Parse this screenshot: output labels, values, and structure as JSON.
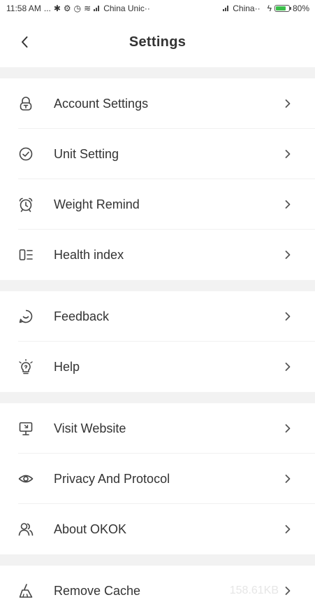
{
  "statusbar": {
    "time": "11:58 AM",
    "indicators": "... ",
    "carrier1": "China Unic··",
    "carrier2": "China··",
    "battery_text": "80%",
    "battery_level": 0.8,
    "battery_color": "#3bbf4a"
  },
  "header": {
    "title": "Settings"
  },
  "groups": [
    {
      "items": [
        {
          "label": "Account Settings",
          "icon": "lock-icon"
        },
        {
          "label": "Unit Setting",
          "icon": "check-circle-icon"
        },
        {
          "label": "Weight Remind",
          "icon": "alarm-clock-icon"
        },
        {
          "label": "Health index",
          "icon": "list-index-icon"
        }
      ]
    },
    {
      "items": [
        {
          "label": "Feedback",
          "icon": "chat-bubble-icon"
        },
        {
          "label": "Help",
          "icon": "lightbulb-icon"
        }
      ]
    },
    {
      "items": [
        {
          "label": "Visit Website",
          "icon": "monitor-icon"
        },
        {
          "label": "Privacy And Protocol",
          "icon": "eye-icon"
        },
        {
          "label": "About OKOK",
          "icon": "users-icon"
        }
      ]
    },
    {
      "items": [
        {
          "label": "Remove Cache",
          "icon": "broom-icon",
          "value": "158.61KB"
        }
      ]
    }
  ],
  "colors": {
    "text": "#333333",
    "section_gap": "#f2f2f2",
    "muted_value": "#e6e6e6"
  }
}
